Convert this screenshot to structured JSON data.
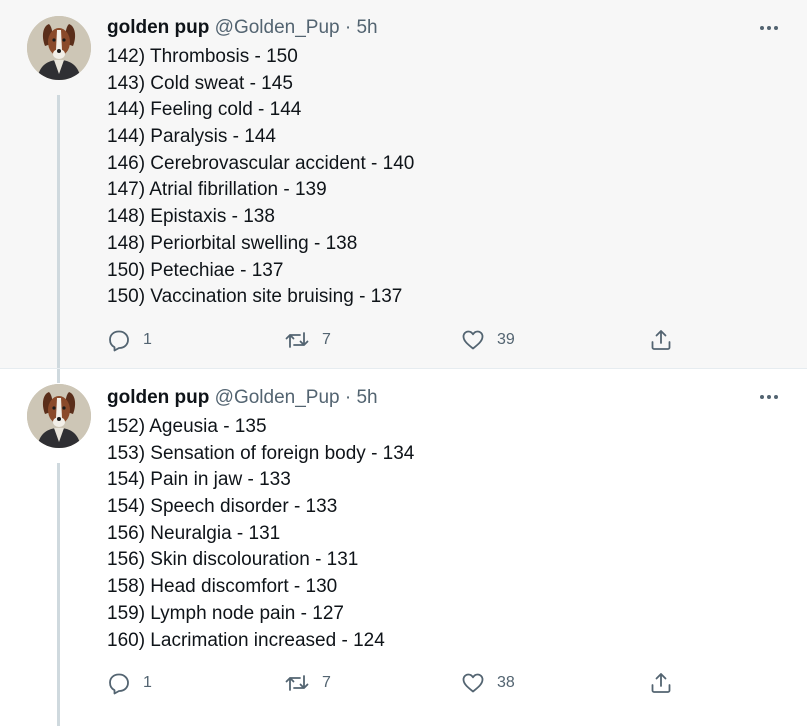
{
  "tweets": [
    {
      "author_name": "golden pup",
      "handle": "@Golden_Pup",
      "separator": "·",
      "time": "5h",
      "lines": [
        "142) Thrombosis - 150",
        "143) Cold sweat - 145",
        "144) Feeling cold - 144",
        "144) Paralysis - 144",
        "146) Cerebrovascular accident - 140",
        "147) Atrial fibrillation - 139",
        "148) Epistaxis - 138",
        "148) Periorbital swelling - 138",
        "150) Petechiae - 137",
        "150) Vaccination site bruising - 137"
      ],
      "reply_count": "1",
      "retweet_count": "7",
      "like_count": "39"
    },
    {
      "author_name": "golden pup",
      "handle": "@Golden_Pup",
      "separator": "·",
      "time": "5h",
      "lines": [
        "152) Ageusia - 135",
        "153) Sensation of foreign body - 134",
        "154) Pain in jaw - 133",
        "154) Speech disorder - 133",
        "156) Neuralgia - 131",
        "156) Skin discolouration - 131",
        "158) Head discomfort - 130",
        "159) Lymph node pain - 127",
        "160) Lacrimation increased - 124"
      ],
      "reply_count": "1",
      "retweet_count": "7",
      "like_count": "38"
    }
  ],
  "icons": {
    "more": "more-icon",
    "reply": "reply-icon",
    "retweet": "retweet-icon",
    "like": "like-icon",
    "share": "share-icon"
  },
  "colors": {
    "highlight_bg": "#f7f7f7",
    "text": "#0f1419",
    "secondary_text": "#536471",
    "thread_line": "#cfd9de"
  }
}
